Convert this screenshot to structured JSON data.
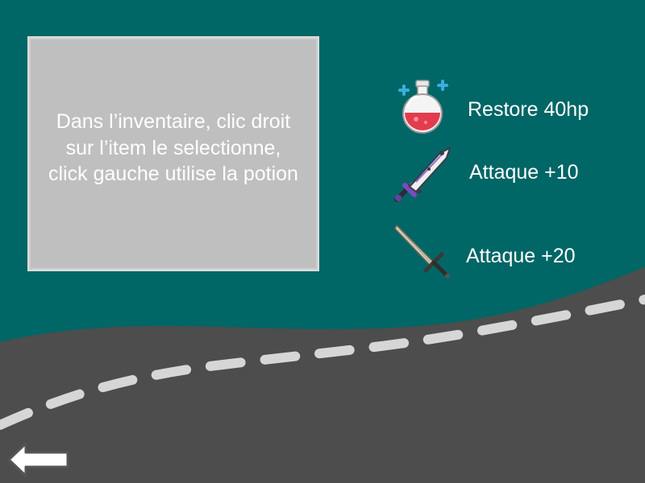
{
  "instructions": {
    "text": "Dans l’inventaire, clic droit sur l’item le selectionne,  click gauche utilise la potion"
  },
  "items": [
    {
      "icon": "health-potion-icon",
      "effect": "Restore 40hp"
    },
    {
      "icon": "dark-sword-icon",
      "effect": "Attaque +10"
    },
    {
      "icon": "steel-sword-icon",
      "effect": "Attaque +20"
    }
  ],
  "back_button": {
    "icon": "left-arrow-icon"
  },
  "colors": {
    "background": "#006666",
    "road": "#4d4d4d",
    "road_line": "#d6d6d6",
    "panel": "#bfbfbf",
    "text": "#ffffff"
  }
}
